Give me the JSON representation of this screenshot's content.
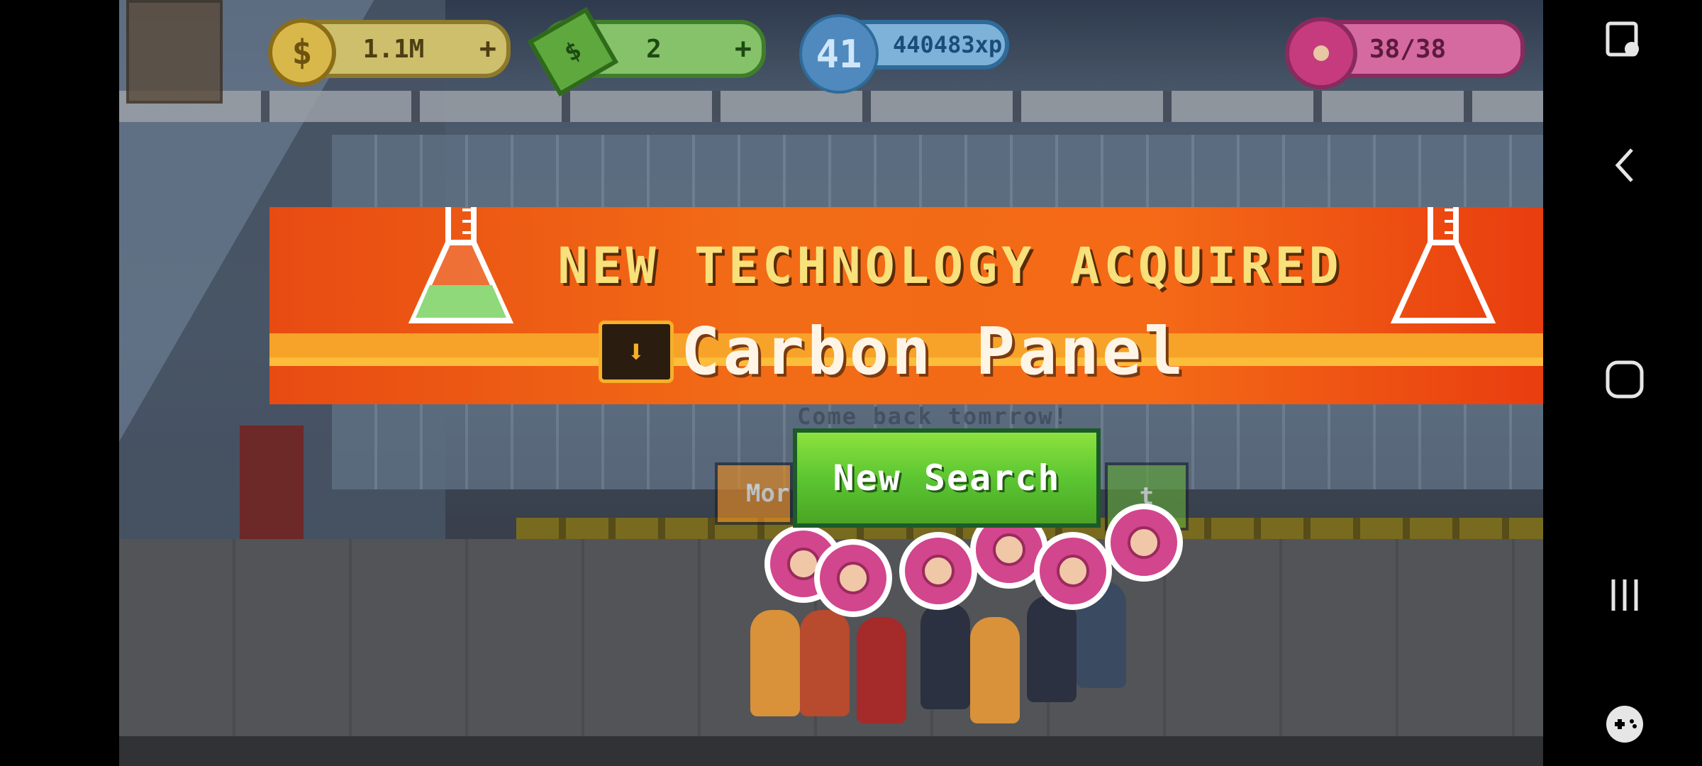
{
  "hud": {
    "coins": "1.1M",
    "cash": "2",
    "level": "41",
    "xp": "440483xp",
    "donuts": "38/38",
    "plus": "+",
    "coin_symbol": "$"
  },
  "banner": {
    "title": "NEW TECHNOLOGY ACQUIRED",
    "item": "Carbon Panel"
  },
  "background_text": {
    "come_back": "Come back tomrrow!",
    "left_button": "Mor",
    "right_button": "t"
  },
  "button": {
    "new_search": "New Search"
  },
  "colors": {
    "banner_orange": "#f26b16",
    "title_yellow": "#f8e07b",
    "button_green": "#5cc632"
  }
}
